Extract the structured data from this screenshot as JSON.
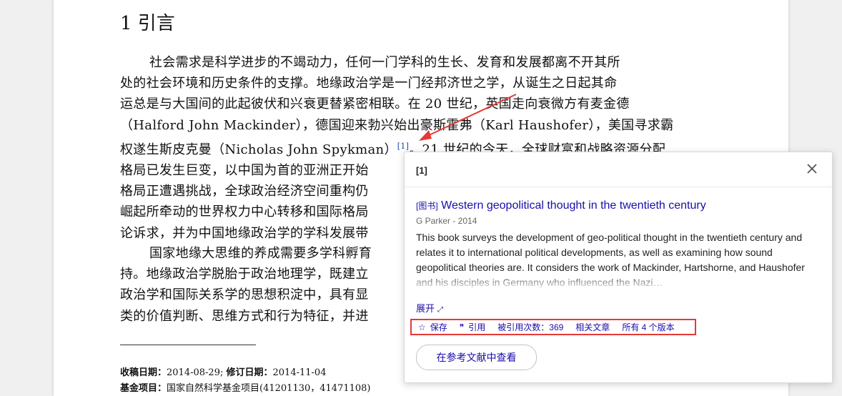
{
  "doc": {
    "section_title": "1  引言",
    "p1": [
      "社会需求是科学进步的不竭动力，任何一门学科的生长、发育和发展都离不开其所",
      "处的社会环境和历史条件的支撑。地缘政治学是一门经邦济世之学，从诞生之日起其命",
      "运总是与大国间的此起彼伏和兴衰更替紧密相联。在 20 世纪，英国走向衰微方有麦金德",
      "（Halford John Mackinder），德国迎来勃兴始出豪斯霍弗（Karl Haushofer），美国寻求霸",
      "权遂生斯皮克曼（Nicholas John Spykman）",
      "。21 世纪的今天，全球财富和战略资源分配",
      "格局已发生巨变，以中国为首的亚洲正开始",
      "格局正遭遇挑战，全球政治经济空间重构仍",
      "崛起所牵动的世界权力中心转移和国际格局",
      "论诉求，并为中国地缘政治学的学科发展带"
    ],
    "cite_marker": "[1]",
    "p2": [
      "国家地缘大思维的养成需要多学科孵育",
      "持。地缘政治学脱胎于政治地理学，既建立",
      "政治学和国际关系学的思想积淀中，具有显",
      "类的价值判断、思维方式和行为特征，并进"
    ],
    "footnote": {
      "received_label": "收稿日期：",
      "received": "2014-08-29;",
      "revised_label": "修订日期：",
      "revised": "2014-11-04",
      "fund_label": "基金项目：",
      "fund": "国家自然科学基金项目(41201130，41471108)"
    }
  },
  "popup": {
    "ref": "[1]",
    "type_tag": "[图书]",
    "title": "Western geopolitical thought in the twentieth century",
    "meta": "G Parker - 2014",
    "abstract": "This book surveys the development of geo-political thought in the twentieth century and relates it to international political developments, as well as examining how sound geopolitical theories are. It considers the work of Mackinder, Hartshorne, and Haushofer and his disciples in Germany who influenced the Nazi…",
    "expand": "展开",
    "actions": {
      "save": "保存",
      "cite": "引用",
      "cited_by": "被引用次数：369",
      "related": "相关文章",
      "versions": "所有 4 个版本"
    },
    "view_in_refs": "在参考文献中查看"
  },
  "icons": {
    "close": "close-icon",
    "star": "star-icon",
    "quote": "quote-icon",
    "expand": "expand-icon"
  },
  "colors": {
    "link": "#1a0dab",
    "highlight_box": "#e53935",
    "arrow": "#e53935"
  }
}
